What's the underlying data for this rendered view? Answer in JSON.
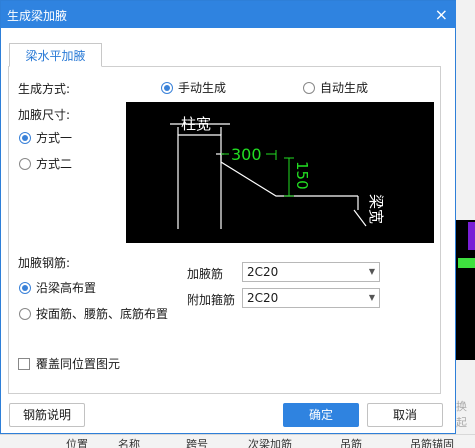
{
  "dialog": {
    "title": "生成梁加腋",
    "close_glyph": "×"
  },
  "tab": {
    "label": "梁水平加腋"
  },
  "generation": {
    "label": "生成方式:",
    "options": [
      "手动生成",
      "自动生成"
    ],
    "selected": "手动生成"
  },
  "size": {
    "label": "加腋尺寸:",
    "options": [
      "方式一",
      "方式二"
    ],
    "selected": "方式一"
  },
  "diagram": {
    "column_width_label": "柱宽",
    "dim_horizontal": "300",
    "dim_vertical": "150",
    "beam_width_label": "梁宽",
    "colors": {
      "background": "#000000",
      "lines": "#ffffff",
      "dimensions": "#22dd22"
    }
  },
  "rebar": {
    "label": "加腋钢筋:",
    "options": [
      "沿梁高布置",
      "按面筋、腰筋、底筋布置"
    ],
    "selected": "沿梁高布置",
    "haunch_bar_label": "加腋筋",
    "haunch_bar_value": "2C20",
    "stirrup_label": "附加箍筋",
    "stirrup_value": "2C20"
  },
  "overwrite": {
    "label": "覆盖同位置图元",
    "checked": false
  },
  "buttons": {
    "rebar_help": "钢筋说明",
    "ok": "确定",
    "cancel": "取消"
  },
  "background": {
    "faint_text": "换起",
    "bottom_columns": [
      "位置",
      "名称",
      "跨号",
      "次梁加筋",
      "吊筋",
      "吊筋锚固"
    ]
  },
  "colors": {
    "titlebar": "#2f83e0",
    "accent": "#3a82d9"
  }
}
